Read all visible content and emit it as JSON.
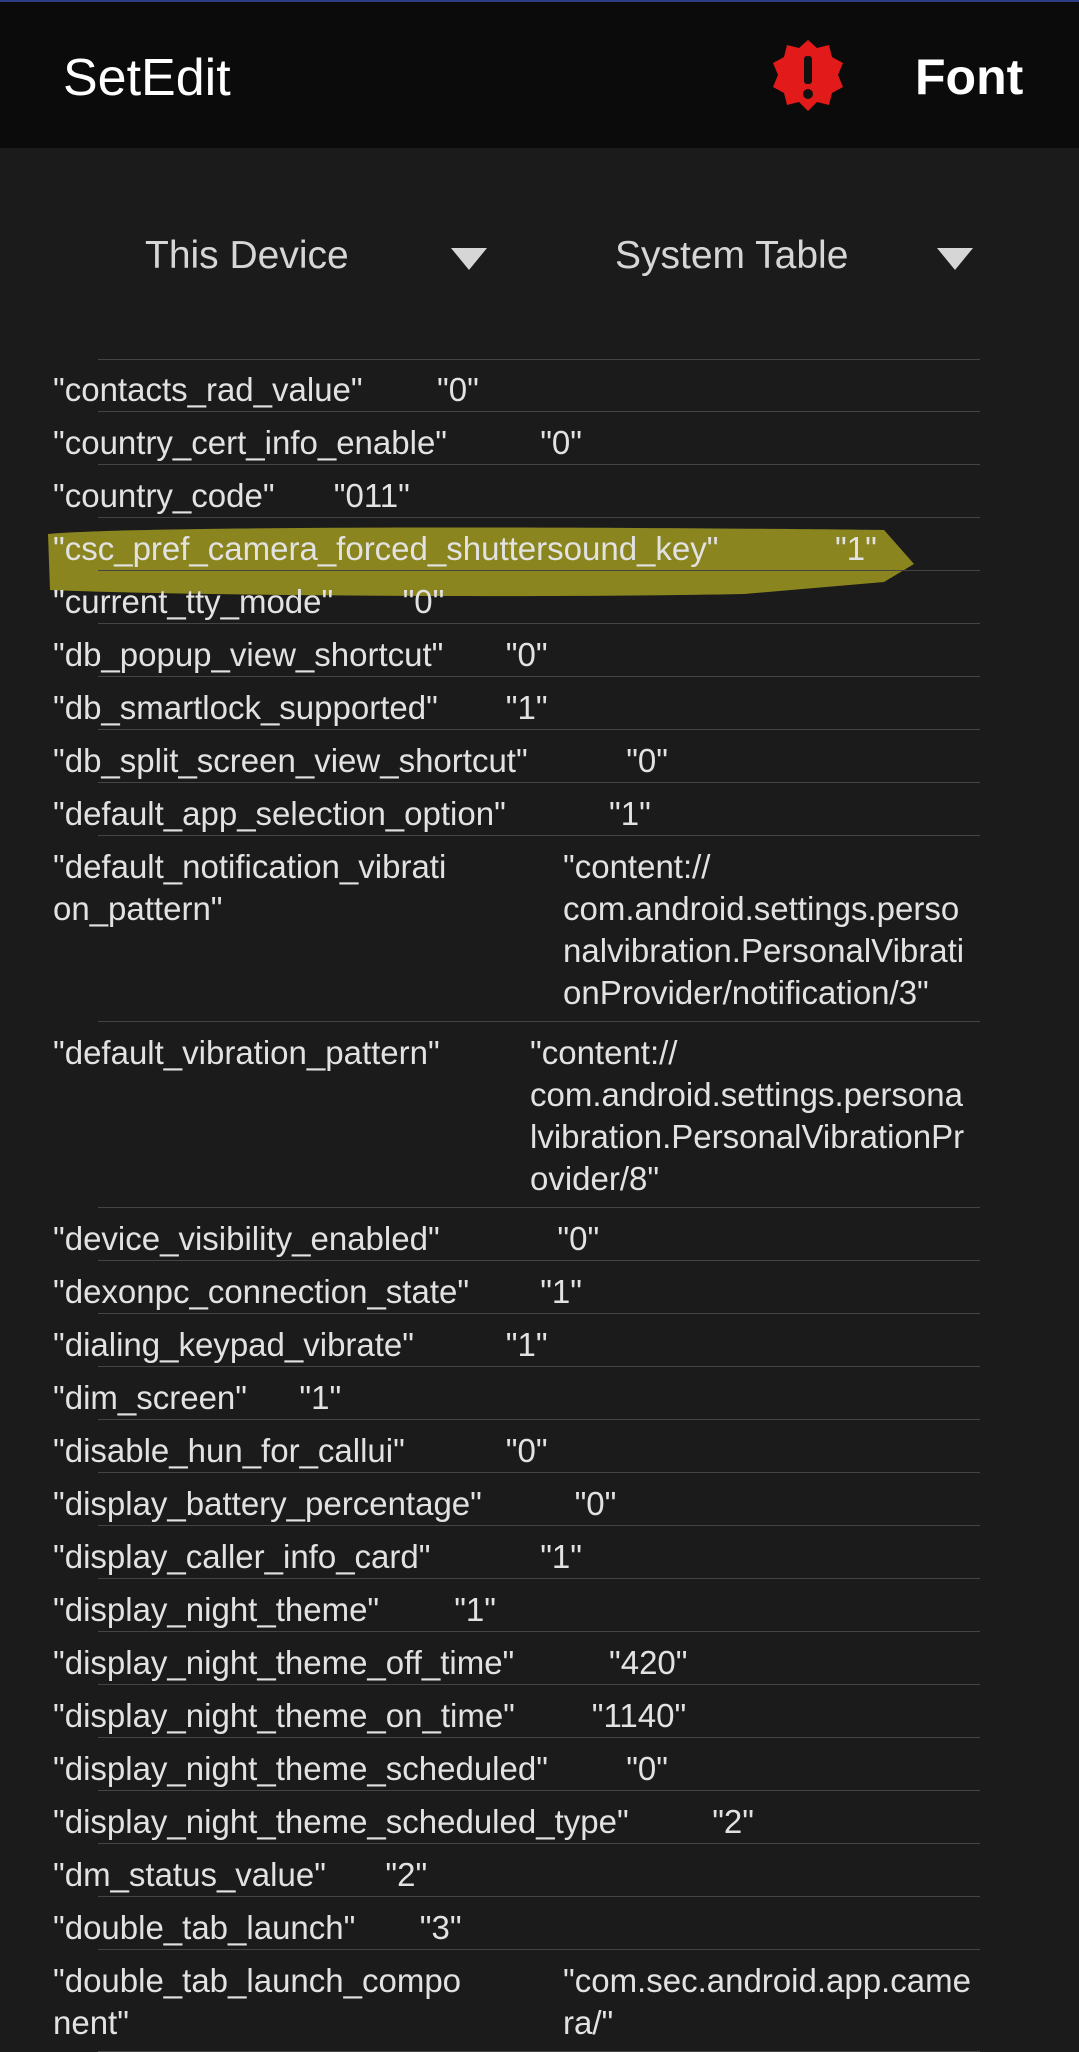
{
  "app": {
    "title": "SetEdit",
    "action_label": "Font",
    "warning_icon": "alert-badge-icon",
    "warning_color": "#e21a1a"
  },
  "spinners": {
    "device": "This Device",
    "table": "System Table"
  },
  "highlight_color": "#a8a020",
  "rows": [
    {
      "key": "\"contacts_rad_value\"",
      "value": "\"0\""
    },
    {
      "key": "\"country_cert_info_enable\"",
      "value": "\"0\""
    },
    {
      "key": "\"country_code\"",
      "value": "\"011\""
    },
    {
      "key": "\"csc_pref_camera_forced_shuttersound_key\"",
      "value": "\"1\""
    },
    {
      "key": "\"current_tty_mode\"",
      "value": "\"0\""
    },
    {
      "key": "\"db_popup_view_shortcut\"",
      "value": "\"0\""
    },
    {
      "key": "\"db_smartlock_supported\"",
      "value": "\"1\""
    },
    {
      "key": "\"db_split_screen_view_shortcut\"",
      "value": "\"0\""
    },
    {
      "key": "\"default_app_selection_option\"",
      "value": "\"1\""
    },
    {
      "key": "\"default_notification_vibrati\non_pattern\"",
      "value": "\"content://\ncom.android.settings.perso\nnalvibration.PersonalVibrati\nonProvider/notification/3\""
    },
    {
      "key": "\"default_vibration_pattern\"",
      "value": "\"content://\ncom.android.settings.persona\nlvibration.PersonalVibrationPr\novider/8\""
    },
    {
      "key": "\"device_visibility_enabled\"",
      "value": "\"0\""
    },
    {
      "key": "\"dexonpc_connection_state\"",
      "value": "\"1\""
    },
    {
      "key": "\"dialing_keypad_vibrate\"",
      "value": "\"1\""
    },
    {
      "key": "\"dim_screen\"",
      "value": "\"1\""
    },
    {
      "key": "\"disable_hun_for_callui\"",
      "value": "\"0\""
    },
    {
      "key": "\"display_battery_percentage\"",
      "value": "\"0\""
    },
    {
      "key": "\"display_caller_info_card\"",
      "value": "\"1\""
    },
    {
      "key": "\"display_night_theme\"",
      "value": "\"1\""
    },
    {
      "key": "\"display_night_theme_off_time\"",
      "value": "\"420\""
    },
    {
      "key": "\"display_night_theme_on_time\"",
      "value": "\"1140\""
    },
    {
      "key": "\"display_night_theme_scheduled\"",
      "value": "\"0\""
    },
    {
      "key": "\"display_night_theme_scheduled_type\"",
      "value": "\"2\""
    },
    {
      "key": "\"dm_status_value\"",
      "value": "\"2\""
    },
    {
      "key": "\"double_tab_launch\"",
      "value": "\"3\""
    },
    {
      "key": "\"double_tab_launch_compo\nnent\"",
      "value": "\"com.sec.android.app.came\nra/\""
    }
  ]
}
